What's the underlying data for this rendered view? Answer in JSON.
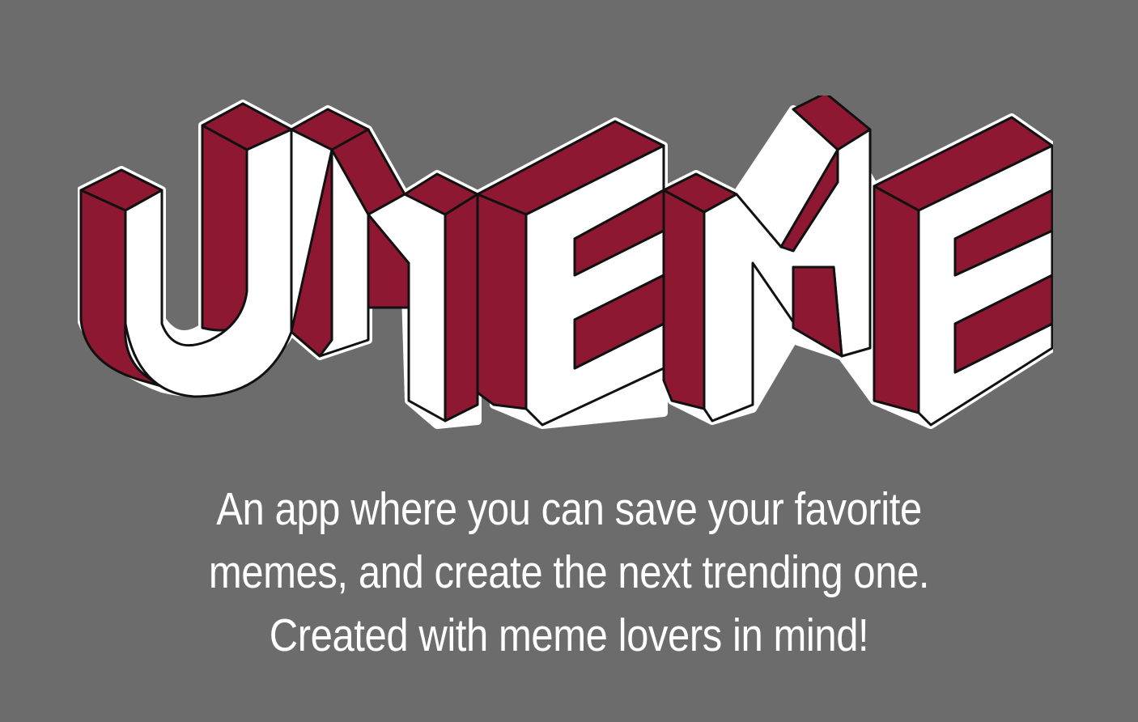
{
  "logo": {
    "text": "UMEME",
    "colors": {
      "face": "#ffffff",
      "side": "#8e1832",
      "outline": "#111111",
      "halo": "#ffffff"
    }
  },
  "tagline": {
    "line1": "An app where you can save your favorite",
    "line2": "memes, and create the next trending one.",
    "line3": "Created with meme lovers in mind!"
  },
  "colors": {
    "background": "#6c6c6c",
    "text": "#ffffff"
  }
}
